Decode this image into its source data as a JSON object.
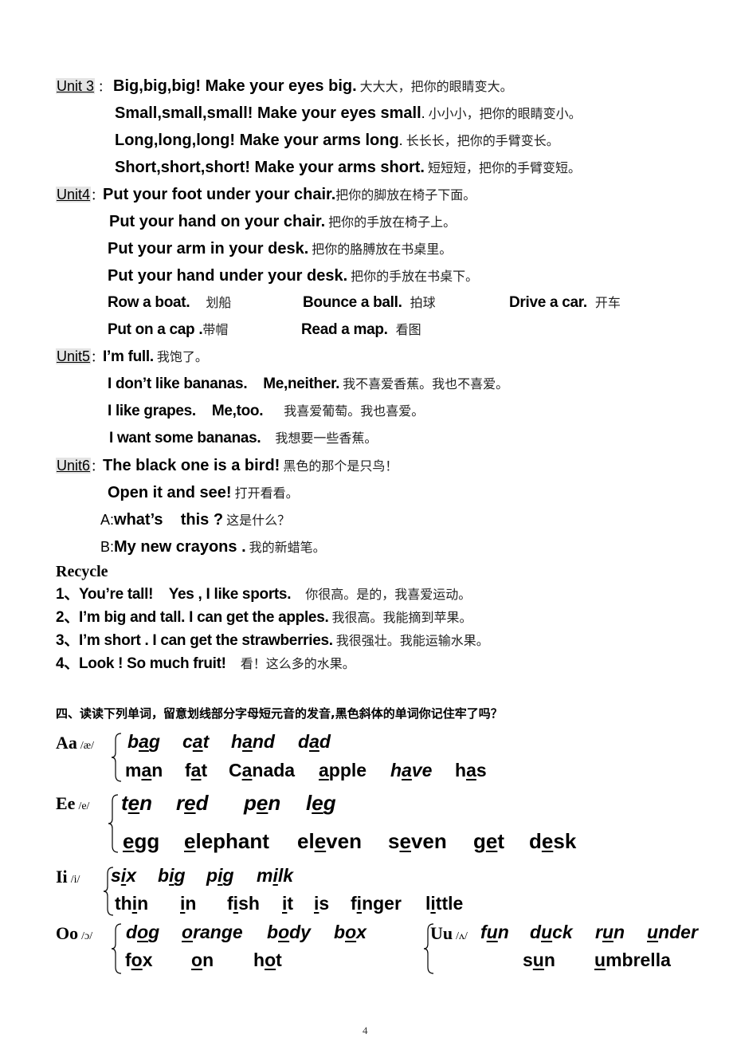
{
  "units": {
    "unit3": {
      "label": "Unit 3",
      "colon": "：",
      "lines": [
        {
          "en": "Big,big,big! Make your eyes big.",
          "zh": "大大大，把你的眼睛变大。"
        },
        {
          "en": "Small,small,small! Make your eyes small",
          "en_tail": ".",
          "zh": "小小小，把你的眼睛变小。"
        },
        {
          "en": "Long,long,long! Make your arms long",
          "en_tail": ".",
          "zh": "长长长，把你的手臂变长。"
        },
        {
          "en": "Short,short,short! Make your arms short.",
          "zh": "短短短，把你的手臂变短。"
        }
      ]
    },
    "unit4": {
      "label": "Unit4",
      "colon": "：",
      "lines": [
        {
          "en": "Put your foot under your chair.",
          "zh": "把你的脚放在椅子下面。"
        },
        {
          "en": "Put your hand on your chair.",
          "zh": "把你的手放在椅子上。"
        },
        {
          "en": "Put your arm in your desk.",
          "zh": "把你的胳膊放在书桌里。"
        },
        {
          "en": "Put your hand under your desk.",
          "zh": "把你的手放在书桌下。"
        }
      ],
      "phrases_row1": [
        {
          "en": "Row a boat.",
          "zh": "划船"
        },
        {
          "en": "Bounce a ball.",
          "zh": "拍球"
        },
        {
          "en": "Drive a car.",
          "zh": "开车"
        }
      ],
      "phrases_row2": [
        {
          "en": "Put on a cap .",
          "zh": "带帽"
        },
        {
          "en": "Read a map.",
          "zh": "看图"
        }
      ]
    },
    "unit5": {
      "label": "Unit5",
      "colon": "：",
      "lines": [
        {
          "en": "I’m full.",
          "zh": "我饱了。"
        },
        {
          "en": "I don’t like bananas.    Me,neither.",
          "zh": "我不喜爱香蕉。我也不喜爱。"
        },
        {
          "en": "I like grapes.    Me,too.",
          "zh": "我喜爱葡萄。我也喜爱。"
        },
        {
          "en": "I want some bananas.",
          "zh": "我想要一些香蕉。"
        }
      ]
    },
    "unit6": {
      "label": "Unit6",
      "colon": "：",
      "lines": [
        {
          "en": "The black one is a bird!",
          "zh": "黑色的那个是只鸟！"
        },
        {
          "en": "Open it and see!",
          "zh": "打开看看。"
        }
      ],
      "dialogue": [
        {
          "speaker": "A:",
          "en": "what’s    this ?",
          "zh": "这是什么？"
        },
        {
          "speaker": "B:",
          "en": "My new crayons .",
          "zh": "我的新蜡笔。"
        }
      ]
    }
  },
  "recycle": {
    "title": "Recycle",
    "items": [
      {
        "num": "1、",
        "en": "You’re tall!    Yes , I like sports.",
        "zh": "你很高。是的，我喜爱运动。"
      },
      {
        "num": "2、",
        "en": "I’m big and tall. I can get the apples.",
        "zh": "我很高。我能摘到苹果。"
      },
      {
        "num": "3、",
        "en": "I’m short . I can get the strawberries.",
        "zh": "我很强壮。我能运输水果。"
      },
      {
        "num": "4、",
        "en": "Look ! So much fruit!",
        "zh": "看！这么多的水果。"
      }
    ]
  },
  "vowels": {
    "title": "四、读读下列单词，留意划线部分字母短元音的发音,黑色斜体的单词你记住牢了吗？",
    "groups": [
      {
        "letter": "Aa",
        "ipa": "/æ/",
        "row1": [
          [
            "b",
            "a",
            "g"
          ],
          [
            "c",
            "a",
            "t"
          ],
          [
            "h",
            "a",
            "nd"
          ],
          [
            "d",
            "a",
            "d"
          ]
        ],
        "row2": [
          [
            "m",
            "a",
            "n"
          ],
          [
            "f",
            "a",
            "t"
          ],
          [
            "C",
            "a",
            "nada"
          ],
          [
            "",
            "a",
            "pple"
          ],
          [
            "h",
            "a",
            "ve"
          ],
          [
            "h",
            "a",
            "s"
          ]
        ]
      },
      {
        "letter": "Ee",
        "ipa": "/e/",
        "row1": [
          [
            "t",
            "e",
            "n"
          ],
          [
            "r",
            "e",
            "d"
          ],
          [
            "p",
            "e",
            "n"
          ],
          [
            "l",
            "e",
            "g"
          ]
        ],
        "row2": [
          [
            "",
            "e",
            "gg"
          ],
          [
            "",
            "e",
            "lephant"
          ],
          [
            "el",
            "e",
            "ven"
          ],
          [
            "s",
            "e",
            "ven"
          ],
          [
            "g",
            "e",
            "t"
          ],
          [
            "d",
            "e",
            "sk"
          ]
        ]
      },
      {
        "letter": "Ii",
        "ipa": "/i/",
        "row1": [
          [
            "s",
            "i",
            "x"
          ],
          [
            "b",
            "i",
            "g"
          ],
          [
            "p",
            "i",
            "g"
          ],
          [
            "m",
            "i",
            "lk"
          ]
        ],
        "row2": [
          [
            "th",
            "i",
            "n"
          ],
          [
            "",
            "i",
            "n"
          ],
          [
            "f",
            "i",
            "sh"
          ],
          [
            "",
            "i",
            "t"
          ],
          [
            "",
            "i",
            "s"
          ],
          [
            "f",
            "i",
            "nger"
          ],
          [
            "l",
            "i",
            "ttle"
          ]
        ]
      },
      {
        "letter": "Oo",
        "ipa": "/ɔ/",
        "row1": [
          [
            "d",
            "o",
            "g"
          ],
          [
            "",
            "o",
            "range"
          ],
          [
            "b",
            "o",
            "dy"
          ],
          [
            "b",
            "o",
            "x"
          ]
        ],
        "row2": [
          [
            "f",
            "o",
            "x"
          ],
          [
            "",
            "o",
            "n"
          ],
          [
            "h",
            "o",
            "t"
          ]
        ]
      },
      {
        "letter": "Uu",
        "ipa": "/ʌ/",
        "row1": [
          [
            "f",
            "u",
            "n"
          ],
          [
            "d",
            "u",
            "ck"
          ],
          [
            "r",
            "u",
            "n"
          ],
          [
            "",
            "u",
            "nder"
          ]
        ],
        "row2": [
          [
            "s",
            "u",
            "n"
          ],
          [
            "",
            "u",
            "mbrella"
          ]
        ]
      }
    ]
  },
  "page_number": "4"
}
